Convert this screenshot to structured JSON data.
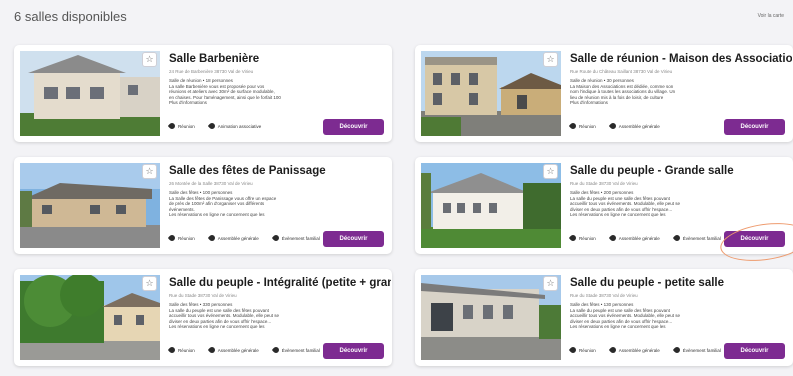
{
  "page": {
    "heading": "6 salles disponibles",
    "top_link": "Voir la carte"
  },
  "colors": {
    "accent": "#7d2b91",
    "background": "#f3f3f6",
    "annotation": "#ee9b6e"
  },
  "cards": [
    {
      "title": "Salle Barbenière",
      "address": "24 Rue de Barbenière 38730 Val de Virieu",
      "description": [
        "Salle de réunion • 18 personnes",
        "La salle Barbenière vous est proposée pour vos",
        "réunions et ateliers avec 30m² de surface modulable,",
        "en chaises. Pour l'aménagement, ainsi que le forfait 100",
        "Plus d'informations"
      ],
      "tags": [
        "Réunion",
        "Animation associative"
      ],
      "button": "Découvrir"
    },
    {
      "title": "Salle de réunion - Maison des Associations",
      "address": "Rue Route du Château Saillant 38730 Val de Virieu",
      "description": [
        "Salle de réunion • 30 personnes",
        "La Maison des Associations est dédiée, comme son",
        "nom l'indique à toutes les associations du village. Un",
        "lieu de réunion mis à la fois de loisir, de culture",
        "Plus d'informations"
      ],
      "tags": [
        "Réunion",
        "Assemblée générale"
      ],
      "button": "Découvrir"
    },
    {
      "title": "Salle des fêtes de Panissage",
      "address": "26 Montée de la Salle 38730 Val de Virieu",
      "description": [
        "Salle des fêtes • 100 personnes",
        "La Salle des fêtes de Panissage vous offre un espace",
        "de près de 100m² afin d'organiser vos différents",
        "événements.",
        "Les réservations en ligne ne concernent que les"
      ],
      "tags": [
        "Réunion",
        "Assemblée générale",
        "Évènement familial"
      ],
      "button": "Découvrir"
    },
    {
      "title": "Salle du peuple - Grande salle",
      "address": "Rue du Stade 38730 Val de Virieu",
      "description": [
        "Salle des fêtes • 200 personnes",
        "La salle du peuple est une salle des fêtes pouvant",
        "accueillir tous vos événements. Modulable, elle peut se",
        "diviser en deux parties afin de vous offrir l'espace...",
        "Les réservations en ligne ne concernent que les"
      ],
      "tags": [
        "Réunion",
        "Assemblée générale",
        "Évènement familial"
      ],
      "button": "Découvrir"
    },
    {
      "title": "Salle du peuple - Intégralité (petite + grand...",
      "address": "Rue du Stade 38730 Val de Virieu",
      "description": [
        "Salle des fêtes • 330 personnes",
        "La salle du peuple est une salle des fêtes pouvant",
        "accueillir tous vos événements. Modulable, elle peut se",
        "diviser en deux parties afin de vous offrir l'espace...",
        "Les réservations en ligne ne concernent que les"
      ],
      "tags": [
        "Réunion",
        "Assemblée générale",
        "Évènement familial"
      ],
      "button": "Découvrir"
    },
    {
      "title": "Salle du peuple - petite salle",
      "address": "Rue du Stade 38730 Val de Virieu",
      "description": [
        "Salle des fêtes • 130 personnes",
        "La salle du peuple est une salle des fêtes pouvant",
        "accueillir tous vos événements. Modulable, elle peut se",
        "diviser en deux parties afin de vous offrir l'espace...",
        "Les réservations en ligne ne concernent que les"
      ],
      "tags": [
        "Réunion",
        "Assemblée générale",
        "Évènement familial"
      ],
      "button": "Découvrir"
    }
  ]
}
